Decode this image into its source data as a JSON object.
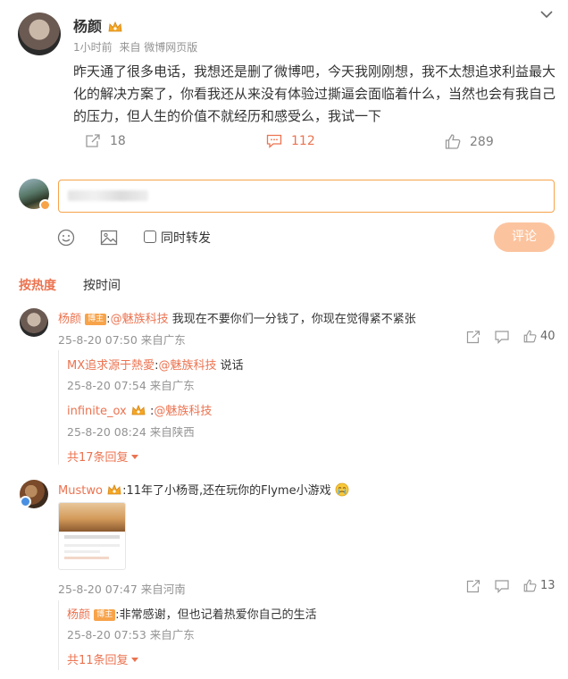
{
  "post": {
    "author": "杨颜",
    "time": "1小时前",
    "source": "来自 微博网页版",
    "text": "昨天通了很多电话，我想还是删了微博吧，今天我刚刚想，我不太想追求利益最大化的解决方案了，你看我还从来没有体验过撕逼会面临着什么，当然也会有我自己的压力，但人生的价值不就经历和感受么，我试一下",
    "reposts": "18",
    "comments": "112",
    "likes": "289"
  },
  "composer": {
    "placeholder": "",
    "sync_repost_label": "同时转发",
    "submit_label": "评论"
  },
  "sort": {
    "hot": "按热度",
    "time": "按时间"
  },
  "comments": [
    {
      "author": "杨颜",
      "badge": "博主",
      "sep": ":",
      "mention": "@魅族科技",
      "text": " 我现在不要你们一分钱了，你现在觉得紧不紧张",
      "meta": "25-8-20 07:50 来自广东",
      "likes": "40",
      "replies": [
        {
          "author": "MX追求源于熱愛",
          "sep": ":",
          "mention": "@魅族科技",
          "text": " 说话",
          "meta": "25-8-20 07:54 来自广东"
        },
        {
          "author": "infinite_ox",
          "sep": ":",
          "mention": "@魅族科技",
          "text": "",
          "meta": "25-8-20 08:24 来自陕西"
        }
      ],
      "more": "共17条回复"
    },
    {
      "author": "Mustwo",
      "sep": ":",
      "text": "11年了小杨哥,还在玩你的Flyme小游戏",
      "meta": "25-8-20 07:47 来自河南",
      "likes": "13",
      "replies": [
        {
          "author": "杨颜",
          "badge": "博主",
          "sep": ":",
          "text": "非常感谢，但也记着热爱你自己的生活",
          "meta": "25-8-20 07:53 来自广东"
        }
      ],
      "more": "共11条回复"
    }
  ],
  "colors": {
    "accent": "#eb7350",
    "submit_bg": "#fbc49f"
  }
}
